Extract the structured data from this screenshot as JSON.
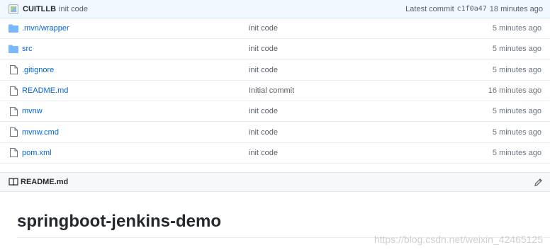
{
  "commit_bar": {
    "author": "CUITLLB",
    "message": "init code",
    "latest_label": "Latest commit",
    "sha": "c1f0a47",
    "age": "18 minutes ago"
  },
  "files": [
    {
      "type": "folder",
      "name": ".mvn/wrapper",
      "message": "init code",
      "age": "5 minutes ago"
    },
    {
      "type": "folder",
      "name": "src",
      "message": "init code",
      "age": "5 minutes ago"
    },
    {
      "type": "file",
      "name": ".gitignore",
      "message": "init code",
      "age": "5 minutes ago"
    },
    {
      "type": "file",
      "name": "README.md",
      "message": "Initial commit",
      "age": "16 minutes ago"
    },
    {
      "type": "file",
      "name": "mvnw",
      "message": "init code",
      "age": "5 minutes ago"
    },
    {
      "type": "file",
      "name": "mvnw.cmd",
      "message": "init code",
      "age": "5 minutes ago"
    },
    {
      "type": "file",
      "name": "pom.xml",
      "message": "init code",
      "age": "5 minutes ago"
    }
  ],
  "readme": {
    "header_label": "README.md",
    "title": "springboot-jenkins-demo"
  },
  "watermark": "https://blog.csdn.net/weixin_42465125",
  "colors": {
    "link": "#0366d6",
    "folder_icon": "#79b8ff",
    "commit_bar_bg": "#f1f8ff"
  }
}
